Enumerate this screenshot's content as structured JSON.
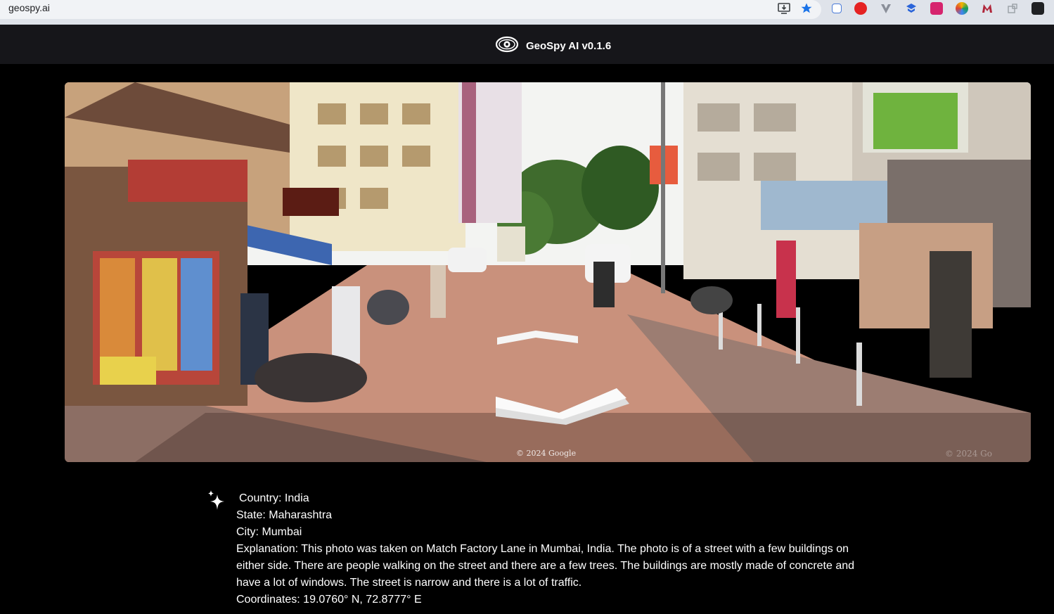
{
  "browser": {
    "url": "geospy.ai",
    "icons": [
      "install-icon",
      "bookmark-star-icon"
    ],
    "extensions": [
      "translate-extension-icon",
      "opera-extension-icon",
      "v-extension-icon",
      "shield-extension-icon",
      "pink-extension-icon",
      "color-extension-icon",
      "m-extension-icon",
      "puzzle-extension-icon",
      "profile-extension-icon"
    ]
  },
  "header": {
    "title": "GeoSpy AI v0.1.6",
    "logo": "eye-logo-icon"
  },
  "street_view": {
    "watermark": "© 2024 Google",
    "watermark_right": "© 2024 Go",
    "controls": [
      "nav-arrow-forward-icon",
      "nav-arrow-back-icon"
    ]
  },
  "result": {
    "icon": "sparkle-icon",
    "country": "Country: India",
    "state": "State: Maharashtra",
    "city": "City: Mumbai",
    "explanation": "Explanation: This photo was taken on Match Factory Lane in Mumbai, India. The photo is of a street with a few buildings on either side. There are people walking on the street and there are a few trees. The buildings are mostly made of concrete and have a lot of windows. The street is narrow and there is a lot of traffic.",
    "coordinates": "Coordinates: 19.0760° N, 72.8777° E"
  },
  "colors": {
    "page_background": "#000000",
    "header_background": "#16161a",
    "text": "#ffffff",
    "bookmark_star": "#1a73e8"
  }
}
